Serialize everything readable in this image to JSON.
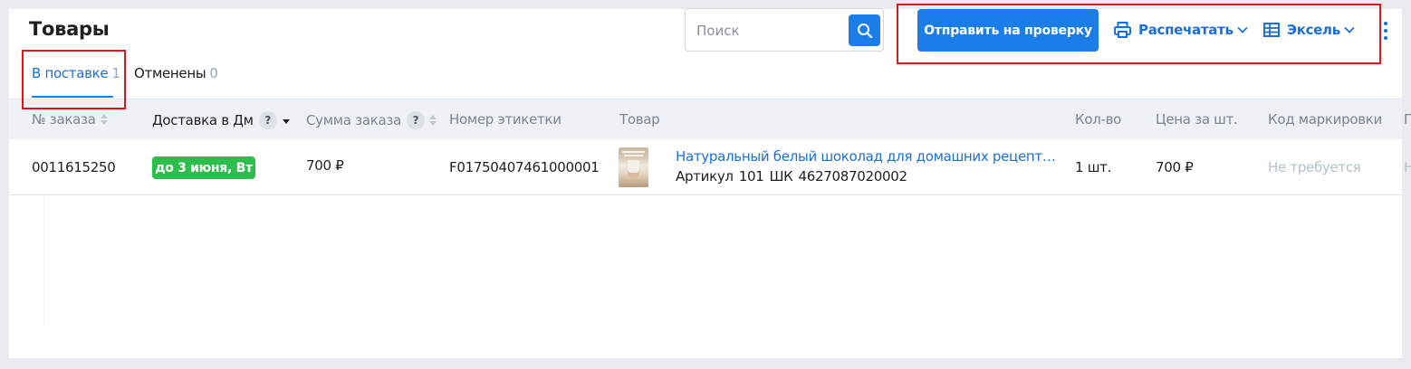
{
  "page": {
    "title": "Товары"
  },
  "search": {
    "placeholder": "Поиск"
  },
  "toolbar": {
    "submit_label": "Отправить на проверку",
    "print_label": "Распечатать",
    "excel_label": "Эксель"
  },
  "tabs": [
    {
      "label": "В поставке",
      "count": "1",
      "active": true
    },
    {
      "label": "Отменены",
      "count": "0",
      "active": false
    }
  ],
  "table": {
    "columns": [
      "№ заказа",
      "Доставка в Дм",
      "Сумма заказа",
      "Номер этикетки",
      "Товар",
      "Кол-во",
      "Цена за шт.",
      "Код маркировки",
      "П"
    ],
    "help_mark": "?",
    "rows": [
      {
        "order_no": "0011615250",
        "delivery": "до 3 июня, Вт",
        "sum": "700 ₽",
        "label_no": "F01750407461000001",
        "product_name": "Натуральный белый шоколад для домашних рецептов в…",
        "article_label": "Артикул",
        "article": "101",
        "barcode_label": "ШК",
        "barcode": "4627087020002",
        "qty": "1 шт.",
        "price": "700 ₽",
        "marking": "Не требуется",
        "extra": "Н"
      }
    ]
  },
  "colors": {
    "accent": "#1b7ee8",
    "link": "#1b6fd6",
    "success": "#2dbf4c",
    "highlight": "#e3141b"
  }
}
